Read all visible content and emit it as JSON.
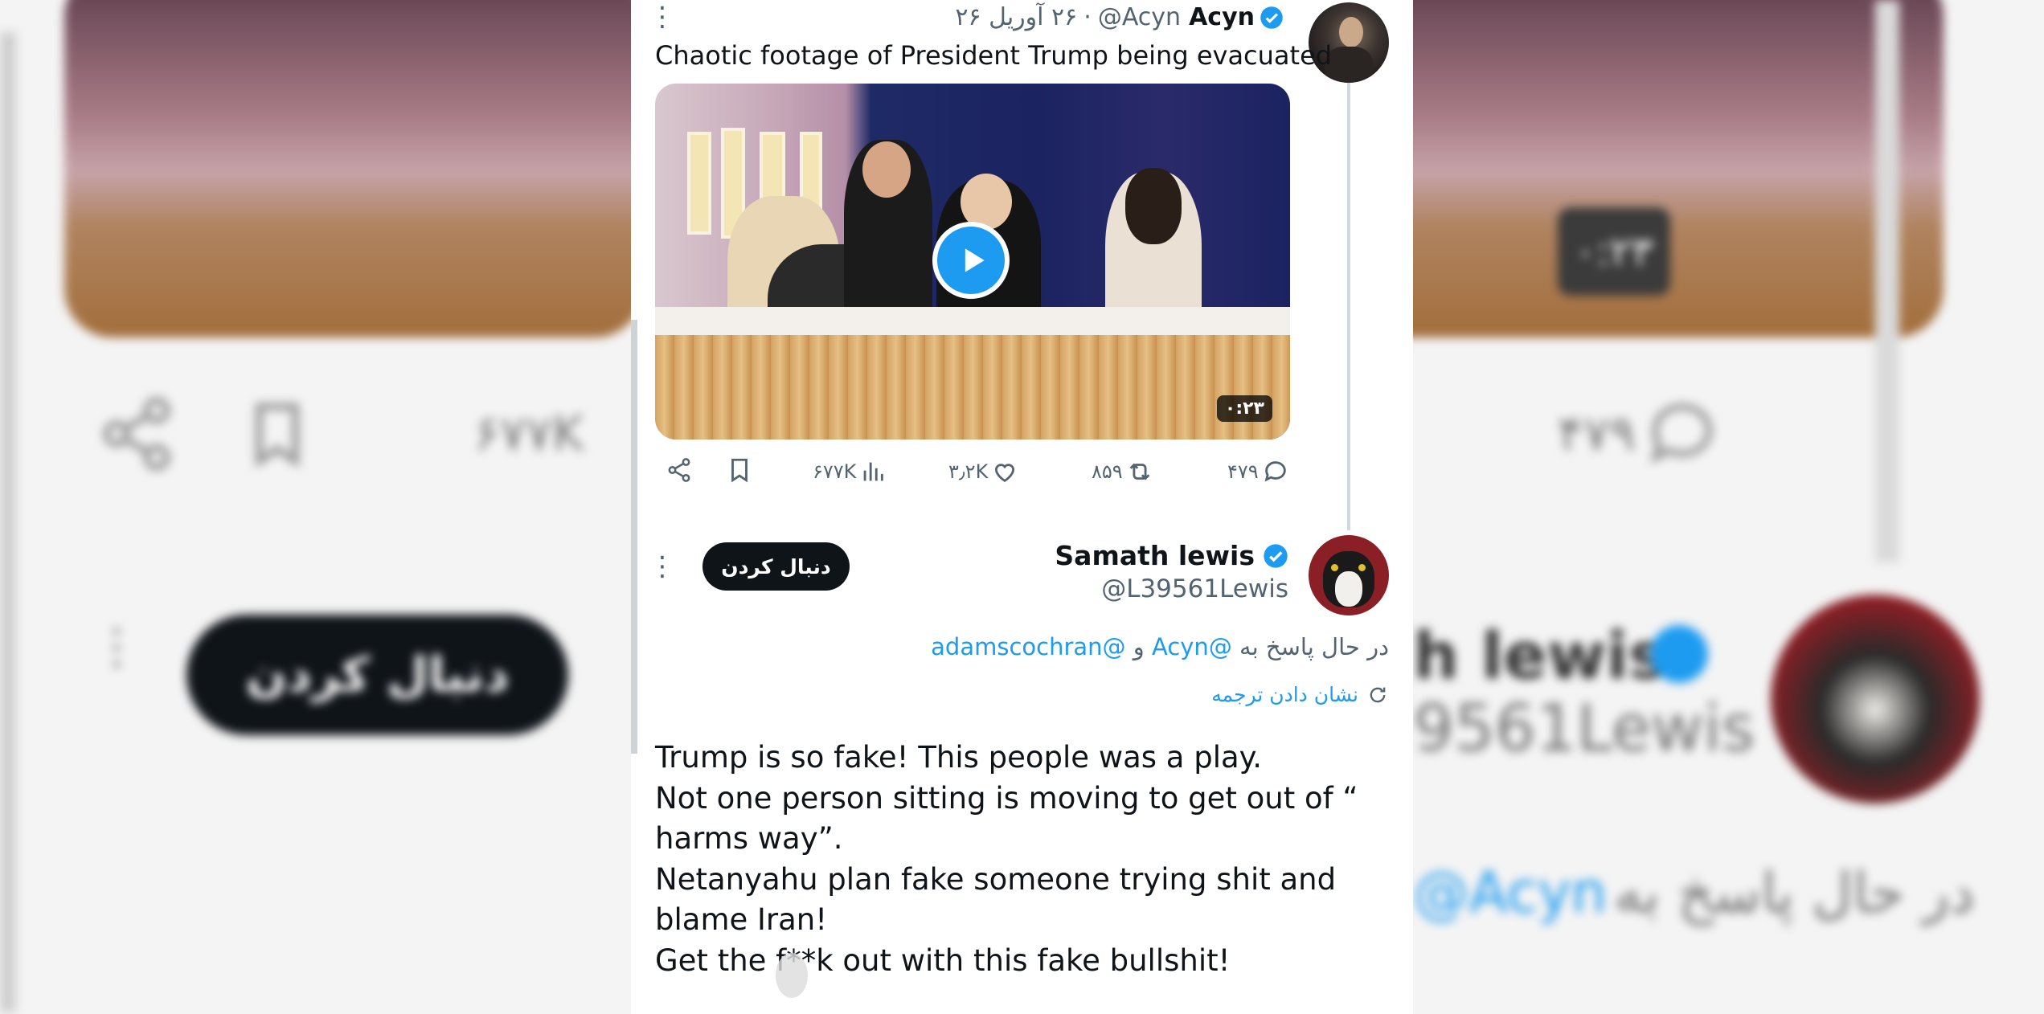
{
  "first_tweet": {
    "name": "Acyn",
    "handle": "@Acyn",
    "date": "۲۶ آوریل ۲۶",
    "separator": "·",
    "text": "Chaotic footage of President Trump being evacuated",
    "video_duration": "۰:۲۳",
    "actions": {
      "replies": "۴۷۹",
      "retweets": "۸۵۹",
      "likes": "۳٫۲K",
      "views": "۶۷۷K"
    }
  },
  "reply_tweet": {
    "name": "Samath lewis",
    "handle": "@L39561Lewis",
    "follow_label": "دنبال کردن",
    "replying_to_prefix": "در حال پاسخ به",
    "mention_1": "@Acyn",
    "conjunction": "و",
    "mention_2": "@adamscochran",
    "translate_label": "نشان دادن ترجمه",
    "body_lines": [
      "Trump is so fake! This people was a play.",
      "Not one person sitting is moving to get out of “",
      "harms way”.",
      "Netanyahu plan fake someone trying shit and",
      "blame Iran!",
      "Get the f**k out with this fake bullshit!"
    ]
  },
  "background": {
    "left_views": "۶۷۷K",
    "left_follow_label": "دنبال کردن",
    "right_replies": "۴۷۹",
    "right_name_fragment": "h lewis",
    "right_handle_fragment": "9561Lewis",
    "right_reply_prefix": "در حال پاسخ به",
    "right_mention": "@Acyn",
    "right_duration": "۰:۲۳"
  },
  "colors": {
    "accent": "#1d9bf0",
    "text": "#0f1419",
    "secondary": "#536471"
  }
}
